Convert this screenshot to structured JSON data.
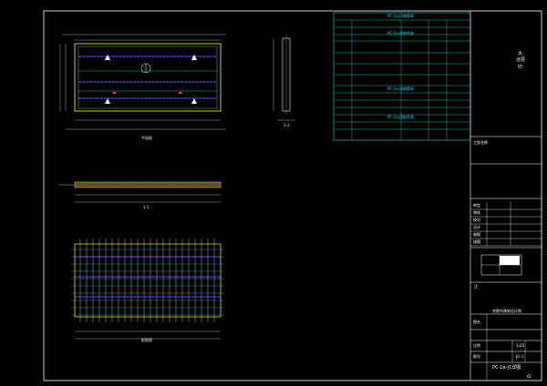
{
  "colors": {
    "background": "#000000",
    "frame": "#ffffff",
    "outline_green": "#3fd24a",
    "cyan": "#20d8d8",
    "purple": "#8a57ff",
    "yellow": "#e8e020",
    "red": "#ff3030"
  },
  "drawing": {
    "plan_view_label": "平面图",
    "section_label": "1-1",
    "rebar_plan_label": "配筋图",
    "side_view_label": "2-2"
  },
  "schedule_table": {
    "title_main": "PC-1a-J1钢筋表",
    "title_sub": "PC-1a-J1构件表",
    "title_mid": "PC-1a-J1钢筋表",
    "title_low": "PC-1a-J1配件表"
  },
  "title_block": {
    "stamp_chars": [
      "大",
      "合层",
      "印"
    ],
    "note_label": "说明事项",
    "project_label": "工程名称",
    "approval_rows": [
      "审定",
      "审核",
      "校对",
      "设计",
      "制图",
      "描图"
    ],
    "notes_text": "注",
    "company_text": "合肥市建筑设计院",
    "sheet_label": "图名",
    "drawing_title": "PC-1a-J1详图",
    "scale_label": "比例",
    "scale_value": "1:25",
    "drawing_no_label": "图号",
    "drawing_no_value": "JG-1",
    "page_no": "01"
  }
}
